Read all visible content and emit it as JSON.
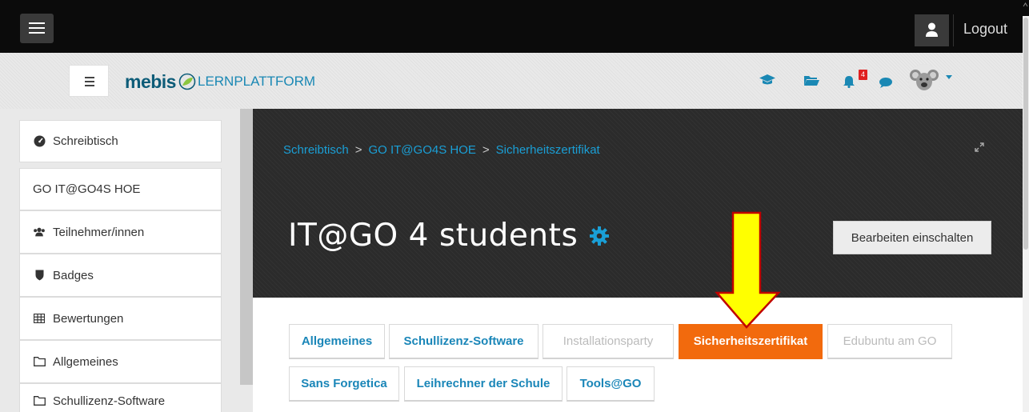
{
  "topbar": {
    "logout_label": "Logout"
  },
  "navbar": {
    "logo_brand": "mebis",
    "logo_product": "LERNPLATTFORM",
    "notification_count": "4"
  },
  "sidebar": {
    "items": [
      {
        "label": "Schreibtisch",
        "icon": "dashboard-icon"
      },
      {
        "label": "GO IT@GO4S HOE",
        "icon": ""
      },
      {
        "label": "Teilnehmer/innen",
        "icon": "users-icon"
      },
      {
        "label": "Badges",
        "icon": "shield-icon"
      },
      {
        "label": "Bewertungen",
        "icon": "table-icon"
      },
      {
        "label": "Allgemeines",
        "icon": "folder-icon"
      },
      {
        "label": "Schullizenz-Software",
        "icon": "folder-icon"
      }
    ]
  },
  "header": {
    "breadcrumb": [
      "Schreibtisch",
      "GO IT@GO4S HOE",
      "Sicherheitszertifikat"
    ],
    "breadcrumb_separator": ">",
    "course_title": "IT@GO 4 students",
    "edit_button_label": "Bearbeiten einschalten"
  },
  "tabs": {
    "row1": [
      {
        "label": "Allgemeines",
        "state": "normal"
      },
      {
        "label": "Schullizenz-Software",
        "state": "normal"
      },
      {
        "label": "Installationsparty",
        "state": "disabled"
      },
      {
        "label": "Sicherheitszertifikat",
        "state": "active"
      },
      {
        "label": "Edubuntu am GO",
        "state": "disabled"
      }
    ],
    "row2": [
      {
        "label": "Sans Forgetica",
        "state": "normal"
      },
      {
        "label": "Leihrechner der Schule",
        "state": "normal"
      },
      {
        "label": "Tools@GO",
        "state": "normal"
      }
    ]
  },
  "colors": {
    "accent": "#1a86b8",
    "active_tab": "#f26a0d",
    "arrow_fill": "#ffff00",
    "arrow_stroke": "#c00000",
    "header_bg": "#2b2b2b",
    "topbar_bg": "#0b0b0b"
  }
}
